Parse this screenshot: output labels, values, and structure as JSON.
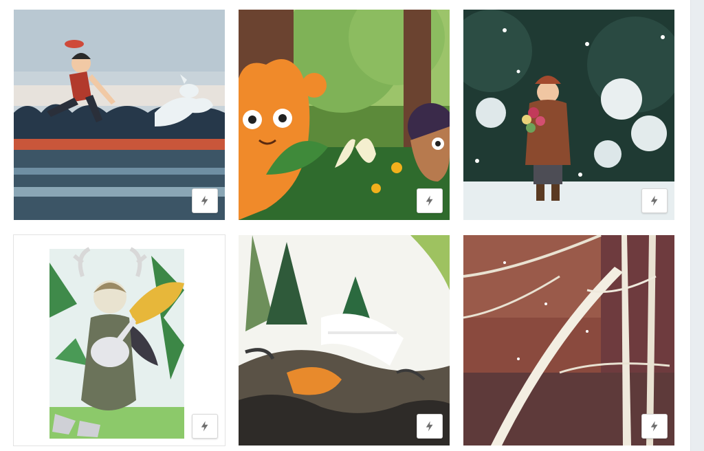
{
  "gallery": {
    "items": [
      {
        "name": "running-boy-dog-illustration",
        "action_icon": "lightning-bolt-icon"
      },
      {
        "name": "forest-creature-illustration",
        "action_icon": "lightning-bolt-icon"
      },
      {
        "name": "snowy-girl-bouquet-illustration",
        "action_icon": "lightning-bolt-icon"
      },
      {
        "name": "fairy-with-rabbit-illustration",
        "action_icon": "lightning-bolt-icon"
      },
      {
        "name": "waterfall-forest-painting",
        "action_icon": "lightning-bolt-icon"
      },
      {
        "name": "birch-trees-painting",
        "action_icon": "lightning-bolt-icon"
      }
    ],
    "icon_color": "#6f6f6f"
  }
}
